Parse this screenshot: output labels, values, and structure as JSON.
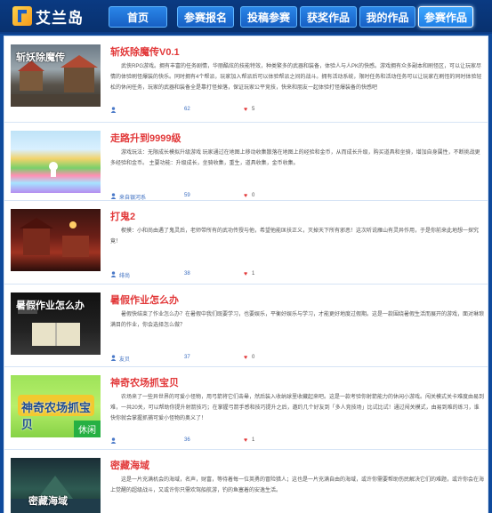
{
  "header": {
    "logo_text": "艾兰岛",
    "nav": [
      {
        "label": "首页",
        "active": false
      },
      {
        "label": "参赛报名",
        "active": false
      },
      {
        "label": "投稿参赛",
        "active": false
      },
      {
        "label": "获奖作品",
        "active": false
      },
      {
        "label": "我的作品",
        "active": false
      },
      {
        "label": "参赛作品",
        "active": true
      }
    ]
  },
  "works": [
    {
      "title": "斩妖除魔传V0.1",
      "thumb_caption": "斩妖除魔传",
      "desc": "武侠RPG游戏。拥有丰富的任务剧情，华丽酷炫的技能特效，种类繁多的武器和装备，体验人与人PK的快感。游戏拥有众多副本和刷怪区，可以让玩家尽情的体验刷怪爆装的快乐。同时拥有4个帮派，玩家加入帮派后可以体验帮派之间的战斗。拥有活动系统，限时任务和活动任务可以让玩家在刷怪的同时体验轻松的休闲任务，玩家的武器和装备全是靠打怪掉落，保证玩家公平竞技，快来和朋友一起体验打怪爆装备的快感吧",
      "author": "",
      "views": "62",
      "likes": "5"
    },
    {
      "title": "走路升到9999级",
      "thumb_caption": "",
      "desc": "游戏玩法：无限成长模拟升级游戏 玩家通过在地图上移动收集散落在地图上的经验和金币，从而成长升级，购买道具和坐骑，增加自身属性，不断挑战更多经验和金币。 主要功能：升级成长，坐骑收集，重生，道具收集，金币收集。",
      "author": "来自银河系",
      "views": "59",
      "likes": "0"
    },
    {
      "title": "打鬼2",
      "thumb_caption": "",
      "desc": "楔摸：小和尚由遇了鬼灵后，老师带所有的武功传授与他，希望他能匡扶正义，灭掉天下所有邪恶！这次听说雁山有灵异作用，于是你前来此地想一探究竟！",
      "author": "绯尚",
      "views": "38",
      "likes": "1"
    },
    {
      "title": "暑假作业怎么办",
      "thumb_caption": "暑假作业怎么办",
      "desc": "暑假快结束了作业怎么办？在暑假中我们既要学习，也要娱乐，平衡好娱乐与学习，才能更好地度过假期。这是一款围绕暑假生活而展开的游戏，面对琳琅满目的作业，你会选择怎么做？",
      "author": "友贝",
      "views": "37",
      "likes": "0"
    },
    {
      "title": "神奇农场抓宝贝",
      "thumb_caption": "神奇农场抓宝贝",
      "thumb_tag": "休闲",
      "desc": "农场来了一些异世界的可爱小怪物，用弓箭将它们击晕，然后装入收纳球里收藏起来吧。这是一款考验你射箭能力的休闲小游戏。闯关模式关卡难度由易到难，一共20关，可以帮助你提升射箭技巧；在掌握弓箭手感和技巧提升之后，邀约几个好友到「多人竞技场」比试比试！通过闯关模式，由易到难的练习，谁快你就会掌握抓捕可爱小怪物的奥义了！",
      "author": "",
      "views": "36",
      "likes": "1"
    },
    {
      "title": "密藏海域",
      "thumb_caption": "密藏海域",
      "desc": "这是一片充满机会的海域，名声，财富，等待着每一位英勇的冒险猎人；这也是一片充满自由的海域，或许你需要帮助伤民解决它们的难题，或许你会在海上觉醒的超级战斗，又或许你只需欢驾船航游，钓的鱼塞着的安逸生活。",
      "author": "",
      "views": "29",
      "likes": "0"
    }
  ],
  "colors": {
    "title_red": "#e2393a",
    "header_blue": "#0a3a82",
    "nav_blue": "#1f7fe6"
  }
}
